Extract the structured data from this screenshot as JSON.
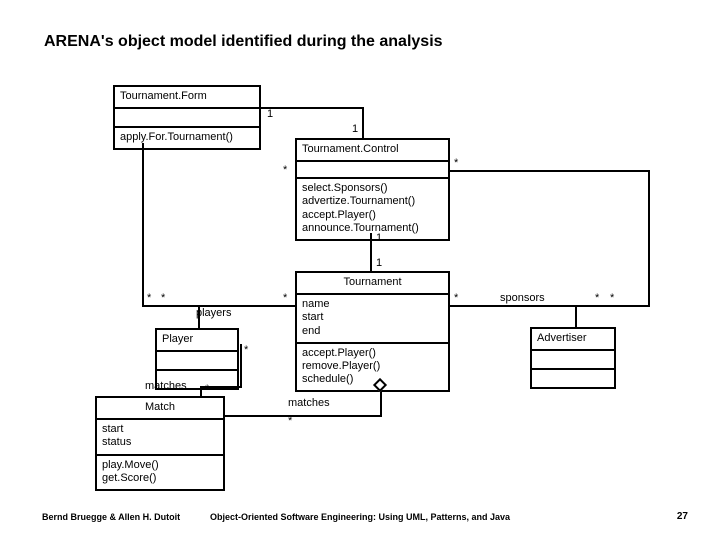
{
  "title": "ARENA's object model identified during the analysis",
  "classes": {
    "tournament_form": {
      "name": "Tournament.Form",
      "ops": [
        "apply.For.Tournament()"
      ]
    },
    "tournament_control": {
      "name": "Tournament.Control",
      "ops": [
        "select.Sponsors()",
        "advertize.Tournament()",
        "accept.Player()",
        "announce.Tournament()"
      ]
    },
    "tournament": {
      "name": "Tournament",
      "attrs": [
        "name",
        "start",
        "end"
      ],
      "ops": [
        "accept.Player()",
        "remove.Player()",
        "schedule()"
      ]
    },
    "player": {
      "name": "Player"
    },
    "advertiser": {
      "name": "Advertiser"
    },
    "match": {
      "name": "Match",
      "attrs": [
        "start",
        "status"
      ],
      "ops": [
        "play.Move()",
        "get.Score()"
      ]
    }
  },
  "labels": {
    "players": "players",
    "sponsors": "sponsors",
    "matches": "matches"
  },
  "mult": {
    "one": "1",
    "star": "*"
  },
  "footer": {
    "left": "Bernd Bruegge & Allen H. Dutoit",
    "center": "Object-Oriented Software Engineering: Using UML, Patterns, and Java",
    "page": "27"
  }
}
